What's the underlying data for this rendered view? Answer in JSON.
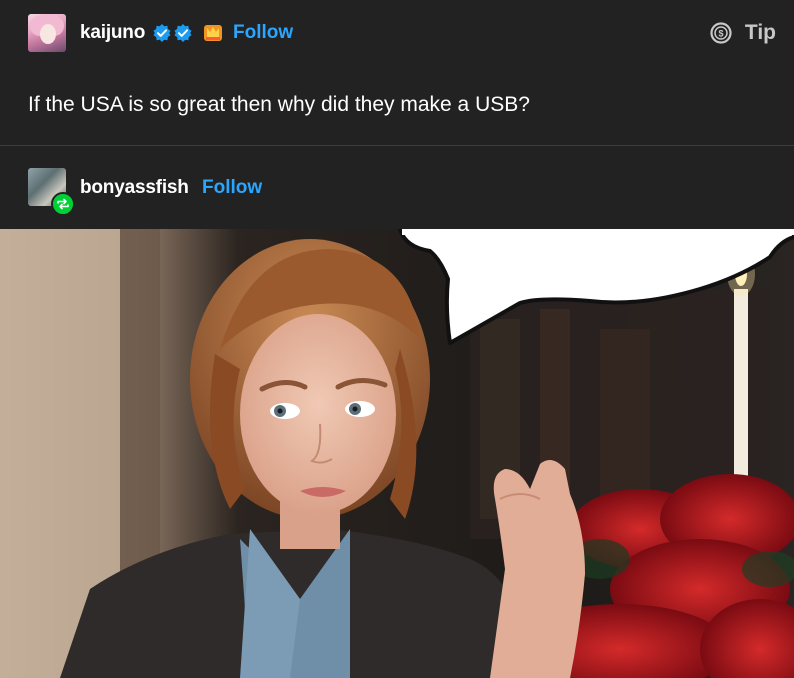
{
  "post": {
    "author": {
      "username": "kaijuno",
      "follow_label": "Follow",
      "badges": [
        "verified-badge-icon",
        "verified-badge-icon",
        "special-badge-icon"
      ]
    },
    "tip": {
      "label": "Tip",
      "icon": "coin-dollar-icon"
    },
    "body_text": "If the USA is so great then why did they make a USB?"
  },
  "reblog": {
    "username": "bonyassfish",
    "follow_label": "Follow",
    "badge_icon": "reblog-icon"
  },
  "colors": {
    "background": "#222222",
    "follow": "#2ba6ff",
    "reblog_badge": "#00cf35",
    "divider": "#3c3c3c"
  }
}
